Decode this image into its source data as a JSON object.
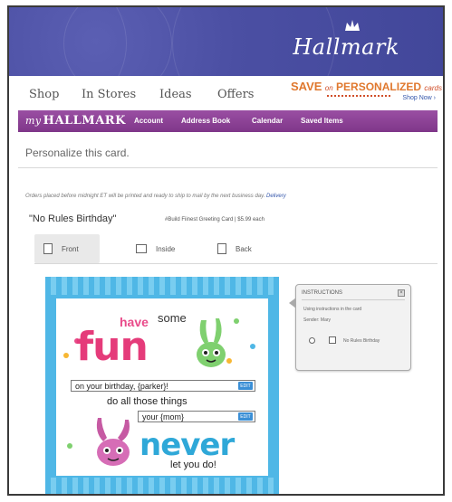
{
  "header": {
    "logo": "Hallmark",
    "logo_icon": "crown-icon",
    "colors": {
      "banner": "#4b4fa3",
      "my_bar": "#8a3f95",
      "accent": "#e53b7a",
      "card_blue": "#4fb7e6"
    }
  },
  "topnav": {
    "items": [
      "Shop",
      "In Stores",
      "Ideas",
      "Offers"
    ]
  },
  "promo": {
    "save": "SAVE",
    "on": "on",
    "personalized": "PERSONALIZED",
    "cards": "cards",
    "cta": "Shop Now ›"
  },
  "my_hallmark": {
    "brand_my": "my",
    "brand_name": "HALLMARK",
    "links": [
      "Account",
      "Address Book",
      "Calendar",
      "Saved Items"
    ]
  },
  "page": {
    "title": "Personalize this card.",
    "notice": "Orders placed before midnight ET will be printed and ready to ship to mail by the next business day.",
    "notice_link": "Delivery",
    "card_name": "\"No Rules Birthday\"",
    "card_meta": "#Build Fiinest Greeting Card | $5.99 each"
  },
  "tabs": [
    {
      "label": "Front",
      "icon": "card-front-icon"
    },
    {
      "label": "Inside",
      "icon": "card-inside-icon"
    },
    {
      "label": "Back",
      "icon": "card-back-icon"
    }
  ],
  "card": {
    "have": "have",
    "some": "some",
    "fun": "fun",
    "field1": "on your birthday, {parker}!",
    "line2": "do all those things",
    "field2": "your {mom}",
    "never": "never",
    "line3": "let you do!",
    "edit": "EDIT"
  },
  "panel": {
    "title": "INSTRUCTIONS",
    "text1": "Using instructions in the card",
    "text2": "Sender: Mary",
    "option": "No Rules Birthday"
  }
}
